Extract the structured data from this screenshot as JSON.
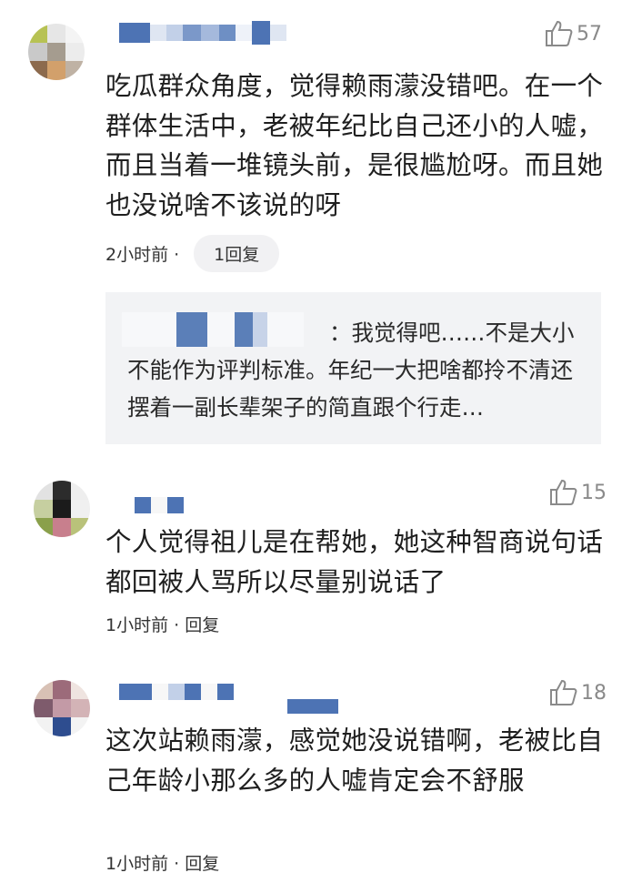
{
  "comments": [
    {
      "likes": "57",
      "text": "吃瓜群众角度，觉得赖雨濛没错吧。在一个群体生活中，老被年纪比自己还小的人嘘，而且当着一堆镜头前，是很尴尬呀。而且她也没说啥不该说的呀",
      "time": "2小时前 ·",
      "reply_label": "1回复",
      "quote": {
        "text": "：我觉得吧……不是大小不能作为评判标准。年纪一大把啥都拎不清还摆着一副长辈架子的简直跟个行走…"
      }
    },
    {
      "likes": "15",
      "text": "个人觉得祖儿是在帮她，她这种智商说句话都回被人骂所以尽量别说话了",
      "time": "1小时前 · 回复"
    },
    {
      "likes": "18",
      "text": "这次站赖雨濛，感觉她没说错啊，老被比自己年龄小那么多的人嘘肯定会不舒服",
      "time": "1小时前 · 回复"
    }
  ],
  "icons": {
    "like": "thumbs-up-icon"
  },
  "colors": {
    "blur_blue": "#5b7fb8",
    "meta_gray": "#8a8a8a",
    "quote_bg": "#f2f3f5"
  }
}
